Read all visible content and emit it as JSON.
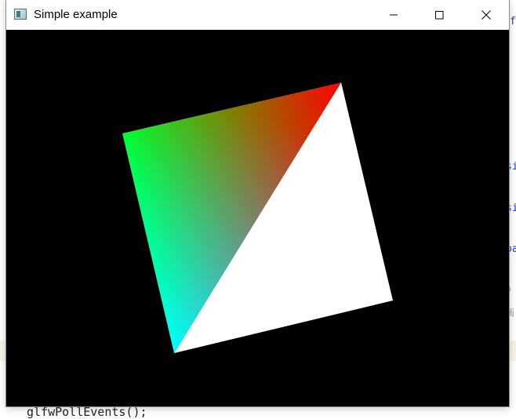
{
  "window": {
    "title": "Simple example",
    "icon": "app-window-icon",
    "controls": {
      "minimize": "minimize-icon",
      "maximize": "maximize-icon",
      "close": "close-icon"
    }
  },
  "scene": {
    "background_color": "#000000",
    "colors": {
      "red": "#ff0000",
      "green": "#00ff00",
      "blue": "#0000ff",
      "white": "#ffffff"
    }
  },
  "background_editor": {
    "fragments": [
      "f",
      "si",
      "si",
      "pa",
      "0 .",
      "画",
      "glfwPollEvents();"
    ]
  }
}
